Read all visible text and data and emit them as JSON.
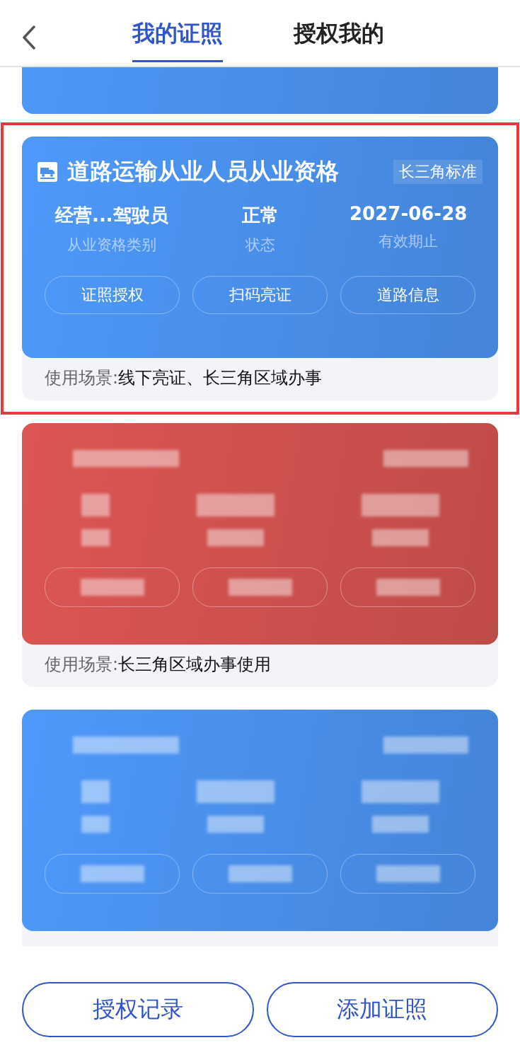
{
  "header": {
    "tabs": [
      {
        "label": "我的证照",
        "selected": true
      },
      {
        "label": "授权我的",
        "selected": false
      }
    ]
  },
  "cards": [
    {
      "kind": "partial",
      "color": "#4a90ec"
    },
    {
      "kind": "full",
      "color": "#4a90ec",
      "highlighted": true,
      "title": "道路运输从业人员从业资格",
      "tag": "长三角标准",
      "fields": [
        {
          "value": "经营...驾驶员",
          "label": "从业资格类别"
        },
        {
          "value": "正常",
          "label": "状态"
        },
        {
          "value": "2027-06-28",
          "label": "有效期止"
        }
      ],
      "actions": [
        "证照授权",
        "扫码亮证",
        "道路信息"
      ],
      "scene_label": "使用场景:",
      "scene_value": "线下亮证、长三角区域办事"
    },
    {
      "kind": "redacted",
      "color": "#d0514e",
      "highlighted": false,
      "scene_label": "使用场景:",
      "scene_value": "长三角区域办事使用"
    },
    {
      "kind": "redacted",
      "color": "#4a90ec",
      "highlighted": false
    }
  ],
  "footer": {
    "buttons": [
      "授权记录",
      "添加证照"
    ]
  }
}
